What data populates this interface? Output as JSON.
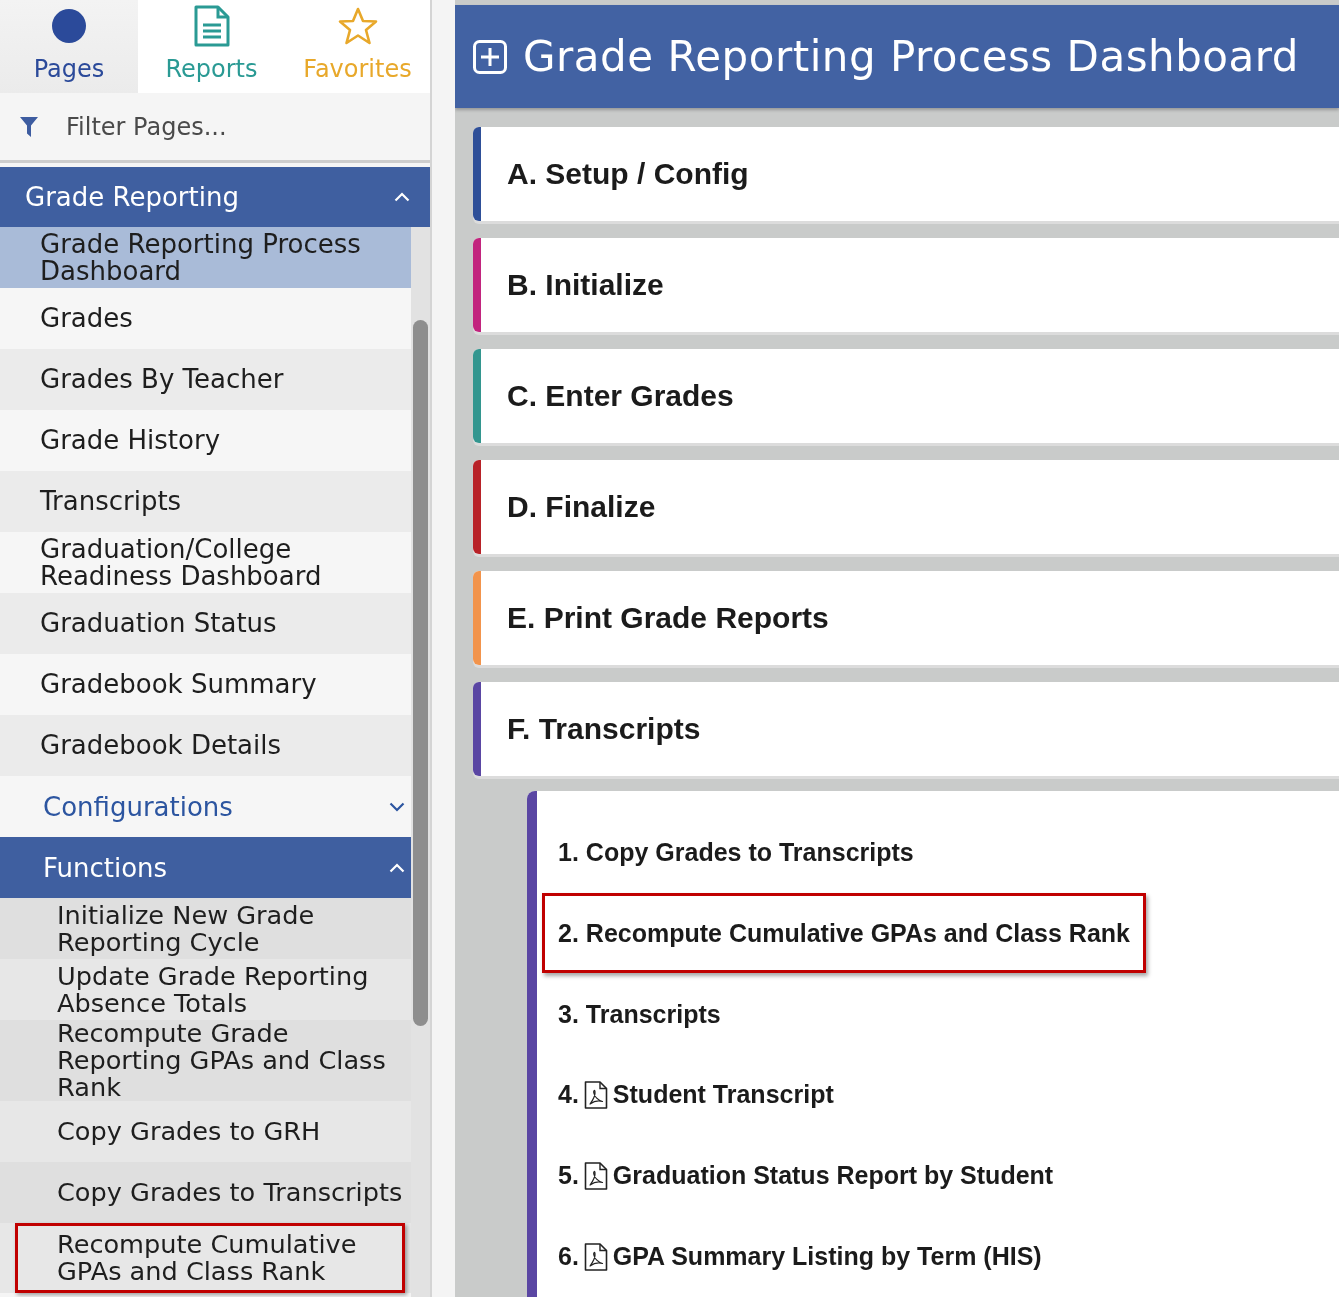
{
  "sidebar": {
    "tabs": [
      {
        "label": "Pages",
        "kind": "pages",
        "color": "#2b4a9a",
        "selected": true
      },
      {
        "label": "Reports",
        "kind": "reports",
        "color": "#2a9a94",
        "selected": false
      },
      {
        "label": "Favorites",
        "kind": "favorites",
        "color": "#e8a82a",
        "selected": false
      }
    ],
    "filter": {
      "placeholder": "Filter Pages..."
    },
    "nav": [
      {
        "label": "Grade Reporting",
        "kind": "group",
        "expanded": true,
        "children": [
          {
            "label": "Grade Reporting Process Dashboard",
            "kind": "page",
            "selected": true,
            "highlighted": false
          },
          {
            "label": "Grades",
            "kind": "page",
            "selected": false,
            "highlighted": false
          },
          {
            "label": "Grades By Teacher",
            "kind": "page",
            "selected": false,
            "highlighted": false
          },
          {
            "label": "Grade History",
            "kind": "page",
            "selected": false,
            "highlighted": false
          },
          {
            "label": "Transcripts",
            "kind": "page",
            "selected": false,
            "highlighted": false
          },
          {
            "label": "Graduation/College Readiness Dashboard",
            "kind": "page",
            "selected": false,
            "highlighted": false
          },
          {
            "label": "Graduation Status",
            "kind": "page",
            "selected": false,
            "highlighted": false
          },
          {
            "label": "Gradebook Summary",
            "kind": "page",
            "selected": false,
            "highlighted": false
          },
          {
            "label": "Gradebook Details",
            "kind": "page",
            "selected": false,
            "highlighted": false
          },
          {
            "label": "Configurations",
            "kind": "group",
            "expanded": false
          },
          {
            "label": "Functions",
            "kind": "group",
            "expanded": true,
            "children": [
              {
                "label": "Initialize New Grade Reporting Cycle",
                "kind": "page",
                "selected": false,
                "highlighted": false
              },
              {
                "label": "Update Grade Reporting Absence Totals",
                "kind": "page",
                "selected": false,
                "highlighted": false
              },
              {
                "label": "Recompute Grade Reporting GPAs and Class Rank",
                "kind": "page",
                "selected": false,
                "highlighted": false
              },
              {
                "label": "Copy Grades to GRH",
                "kind": "page",
                "selected": false,
                "highlighted": false
              },
              {
                "label": "Copy Grades to Transcripts",
                "kind": "page",
                "selected": false,
                "highlighted": false
              },
              {
                "label": "Recompute Cumulative GPAs and Class Rank",
                "kind": "page",
                "selected": false,
                "highlighted": true
              }
            ]
          }
        ]
      }
    ]
  },
  "dashboard": {
    "title": "Grade Reporting Process Dashboard",
    "sections": [
      {
        "label": "A. Setup / Config",
        "color": "#2e4f98"
      },
      {
        "label": "B. Initialize",
        "color": "#c2247e"
      },
      {
        "label": "C. Enter Grades",
        "color": "#33968f"
      },
      {
        "label": "D. Finalize",
        "color": "#b82228"
      },
      {
        "label": "E. Print Grade Reports",
        "color": "#f2944c"
      },
      {
        "label": "F. Transcripts",
        "color": "#5a46a3",
        "children": [
          {
            "number": "1.",
            "label": "Copy Grades to Transcripts",
            "kind": "function",
            "highlighted": false
          },
          {
            "number": "2.",
            "label": "Recompute Cumulative GPAs and Class Rank",
            "kind": "function",
            "highlighted": true
          },
          {
            "number": "3.",
            "label": "Transcripts",
            "kind": "function",
            "highlighted": false
          },
          {
            "number": "4.",
            "label": "Student Transcript",
            "kind": "pdf",
            "highlighted": false
          },
          {
            "number": "5.",
            "label": "Graduation Status Report by Student",
            "kind": "pdf",
            "highlighted": false
          },
          {
            "number": "6.",
            "label": "GPA Summary Listing by Term (HIS)",
            "kind": "pdf",
            "highlighted": false
          }
        ]
      }
    ]
  }
}
